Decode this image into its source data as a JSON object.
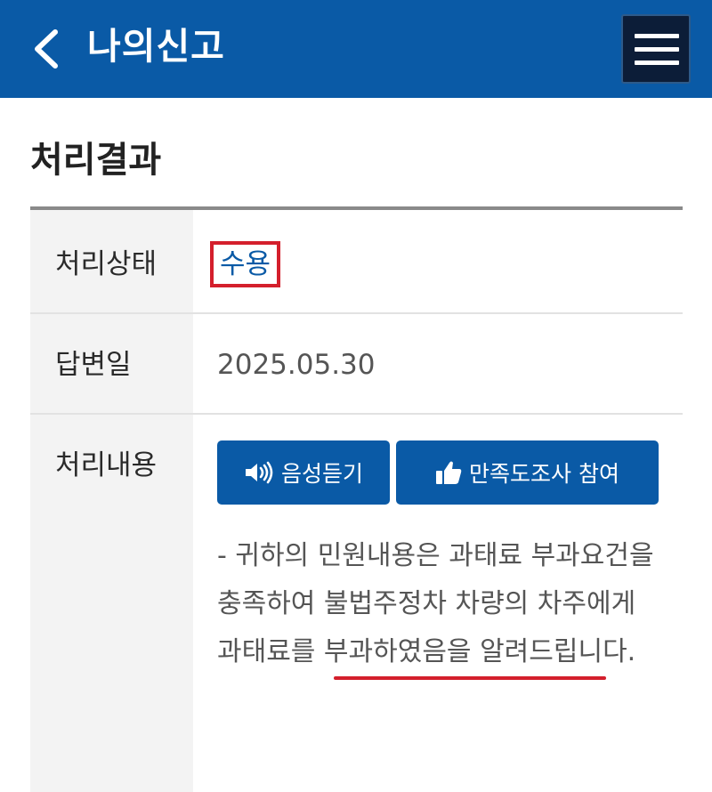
{
  "header": {
    "title": "나의신고",
    "back_icon": "chevron-left-icon",
    "menu_icon": "hamburger-menu-icon",
    "background": "#0a5aa6"
  },
  "section": {
    "title": "처리결과"
  },
  "rows": {
    "status": {
      "label": "처리상태",
      "value": "수용"
    },
    "reply_date": {
      "label": "답변일",
      "value": "2025.05.30"
    },
    "content": {
      "label": "처리내용",
      "listen_button": {
        "label": "음성듣기",
        "icon": "speaker-icon"
      },
      "survey_button": {
        "label": "만족도조사 참여",
        "icon": "thumbs-up-icon"
      },
      "text": "- 귀하의 민원내용은 과태료 부과요건을 충족하여 불법주정차 차량의 차주에게 과태료를 부과하였음을 알려드립니다."
    }
  },
  "colors": {
    "accent": "#0a5aa6",
    "highlight": "#d41f2c"
  }
}
